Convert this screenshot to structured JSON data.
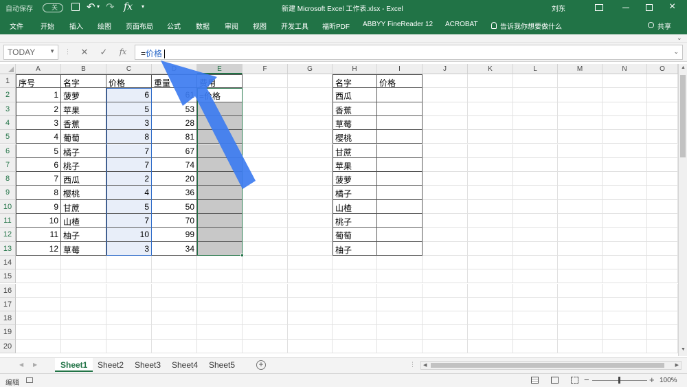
{
  "titlebar": {
    "autosave": "自动保存",
    "autosave_state": "关",
    "title": "新建 Microsoft Excel 工作表.xlsx  -  Excel",
    "user": "刘东"
  },
  "menu": [
    "文件",
    "开始",
    "插入",
    "绘图",
    "页面布局",
    "公式",
    "数据",
    "审阅",
    "视图",
    "开发工具",
    "福昕PDF",
    "ABBYY FineReader 12",
    "ACROBAT"
  ],
  "tellme": "告诉我你想要做什么",
  "share": "共享",
  "formula_bar": {
    "namebox": "TODAY",
    "prefix": "=",
    "ref": "价格"
  },
  "columns": [
    "A",
    "B",
    "C",
    "D",
    "E",
    "F",
    "G",
    "H",
    "I",
    "J",
    "K",
    "L",
    "M",
    "N",
    "O"
  ],
  "rows": [
    "1",
    "2",
    "3",
    "4",
    "5",
    "6",
    "7",
    "8",
    "9",
    "10",
    "11",
    "12",
    "13",
    "14",
    "15",
    "16",
    "17",
    "18",
    "19",
    "20"
  ],
  "table1": {
    "headers": [
      "序号",
      "名字",
      "价格",
      "重量",
      "费用"
    ],
    "rows": [
      [
        "1",
        "菠萝",
        "6",
        "61",
        "=价格"
      ],
      [
        "2",
        "苹果",
        "5",
        "53",
        ""
      ],
      [
        "3",
        "香蕉",
        "3",
        "28",
        ""
      ],
      [
        "4",
        "葡萄",
        "8",
        "81",
        ""
      ],
      [
        "5",
        "橘子",
        "7",
        "67",
        ""
      ],
      [
        "6",
        "桃子",
        "7",
        "74",
        ""
      ],
      [
        "7",
        "西瓜",
        "2",
        "20",
        ""
      ],
      [
        "8",
        "樱桃",
        "4",
        "36",
        ""
      ],
      [
        "9",
        "甘蔗",
        "5",
        "50",
        ""
      ],
      [
        "10",
        "山楂",
        "7",
        "70",
        ""
      ],
      [
        "11",
        "柚子",
        "10",
        "99",
        ""
      ],
      [
        "12",
        "草莓",
        "3",
        "34",
        ""
      ]
    ]
  },
  "table2": {
    "headers": [
      "名字",
      "价格"
    ],
    "names": [
      "西瓜",
      "香蕉",
      "草莓",
      "樱桃",
      "甘蔗",
      "苹果",
      "菠萝",
      "橘子",
      "山楂",
      "桃子",
      "葡萄",
      "柚子"
    ]
  },
  "sheets": [
    "Sheet1",
    "Sheet2",
    "Sheet3",
    "Sheet4",
    "Sheet5"
  ],
  "status": {
    "mode": "编辑",
    "zoom": "100%"
  },
  "colors": {
    "excel_green": "#217346",
    "arrow_blue": "#3d7cf0",
    "range_fill": "#e8eef9",
    "range_border": "#2e6bc8",
    "gray_fill": "#c8c8c8"
  }
}
